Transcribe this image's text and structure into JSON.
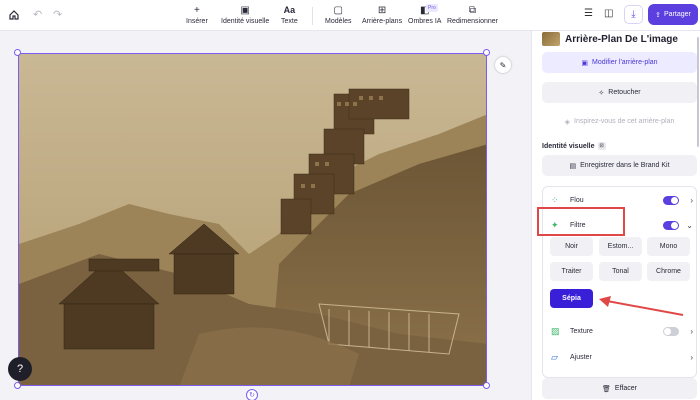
{
  "toolbar": {
    "tools": [
      {
        "label": "Insérer",
        "icon": "plus-icon"
      },
      {
        "label": "Identité visuelle",
        "icon": "brand-icon"
      },
      {
        "label": "Texte",
        "icon": "text-icon"
      },
      {
        "label": "Modèles",
        "icon": "template-icon"
      },
      {
        "label": "Arrière-plans",
        "icon": "background-icon"
      },
      {
        "label": "Ombres IA",
        "icon": "shadow-icon"
      },
      {
        "label": "Redimensionner",
        "icon": "resize-icon"
      }
    ],
    "pro_badge": "Pro",
    "share_label": "Partager"
  },
  "panel": {
    "title": "Arrière-Plan De L'image",
    "modify_bg": "Modifier l'arrière-plan",
    "retouch": "Retoucher",
    "inspire": "Inspirez-vous de cet arrière-plan",
    "brand_section": "Identité visuelle",
    "brand_badge": "⊡",
    "save_brand_kit": "Enregistrer dans le Brand Kit",
    "effects": {
      "flou": "Flou",
      "filtre": "Filtre",
      "texture": "Texture",
      "ajuster": "Ajuster"
    },
    "filters": [
      "Noir",
      "Estom...",
      "Mono",
      "Traiter",
      "Tonal",
      "Chrome",
      "Sépia"
    ],
    "clear": "Effacer"
  },
  "colors": {
    "accent": "#5b3fdf",
    "highlight": "#e04848",
    "sepia": "#a88a5a"
  }
}
